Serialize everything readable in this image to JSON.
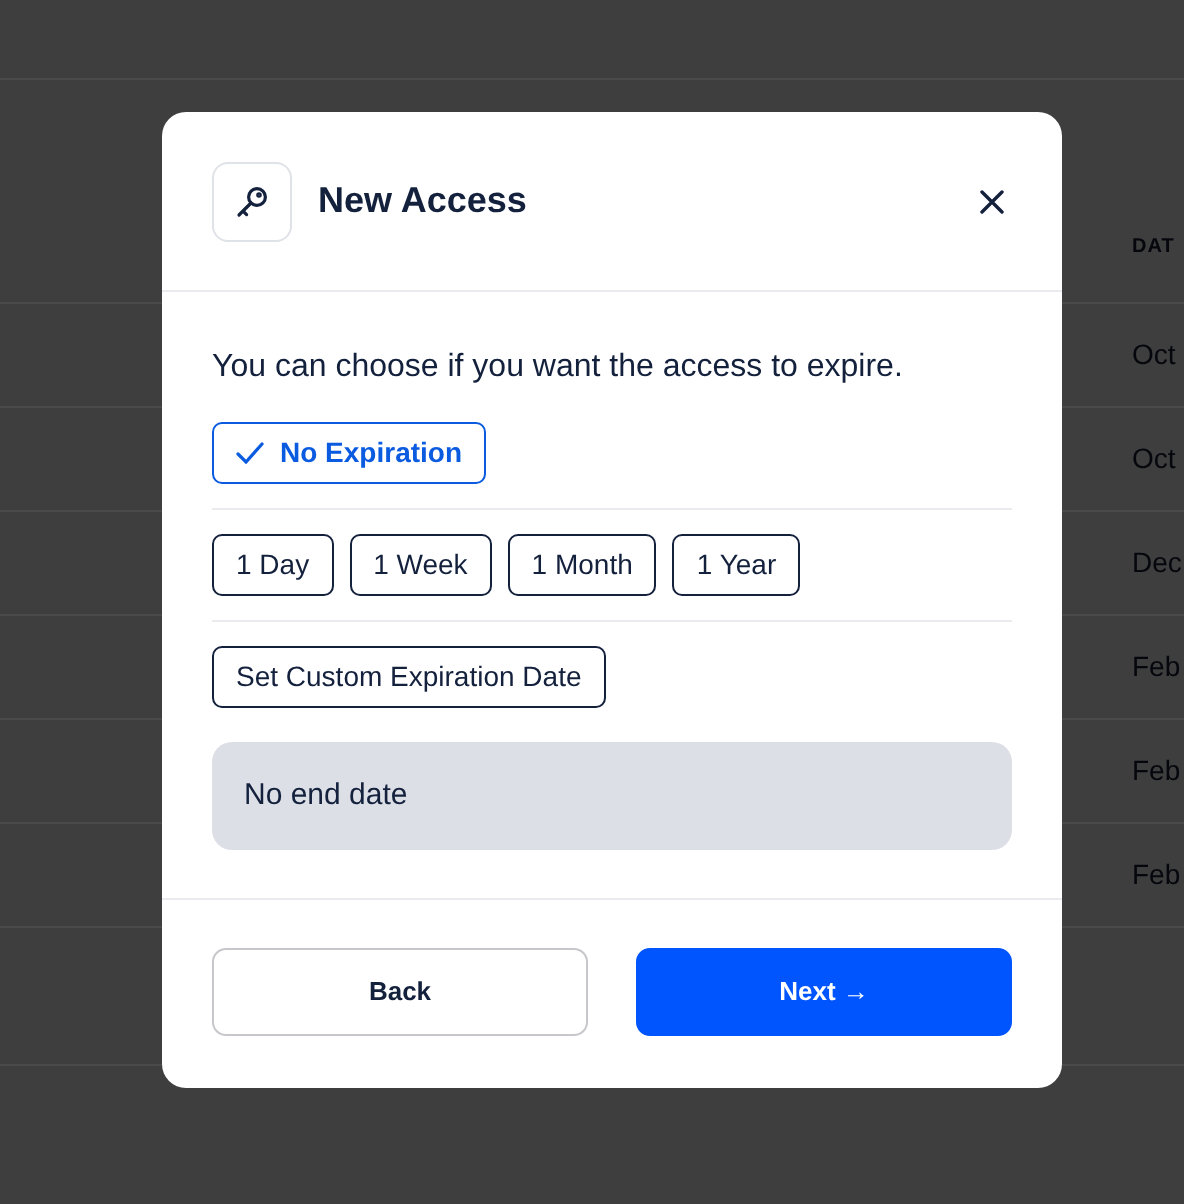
{
  "background_table": {
    "columns": [
      "DAT"
    ],
    "rows": [
      "Oct",
      "Oct",
      "Dec",
      "Feb",
      "Feb",
      "Feb"
    ]
  },
  "dialog": {
    "title": "New Access",
    "description": "You can choose if you want the access to expire.",
    "option_groups": [
      [
        {
          "label": "No Expiration",
          "selected": true
        }
      ],
      [
        {
          "label": "1 Day",
          "selected": false
        },
        {
          "label": "1 Week",
          "selected": false
        },
        {
          "label": "1 Month",
          "selected": false
        },
        {
          "label": "1 Year",
          "selected": false
        }
      ],
      [
        {
          "label": "Set Custom Expiration Date",
          "selected": false
        }
      ]
    ],
    "summary": "No end date",
    "buttons": [
      {
        "label": "Back",
        "kind": "secondary"
      },
      {
        "label": "Next →",
        "kind": "primary"
      }
    ]
  }
}
